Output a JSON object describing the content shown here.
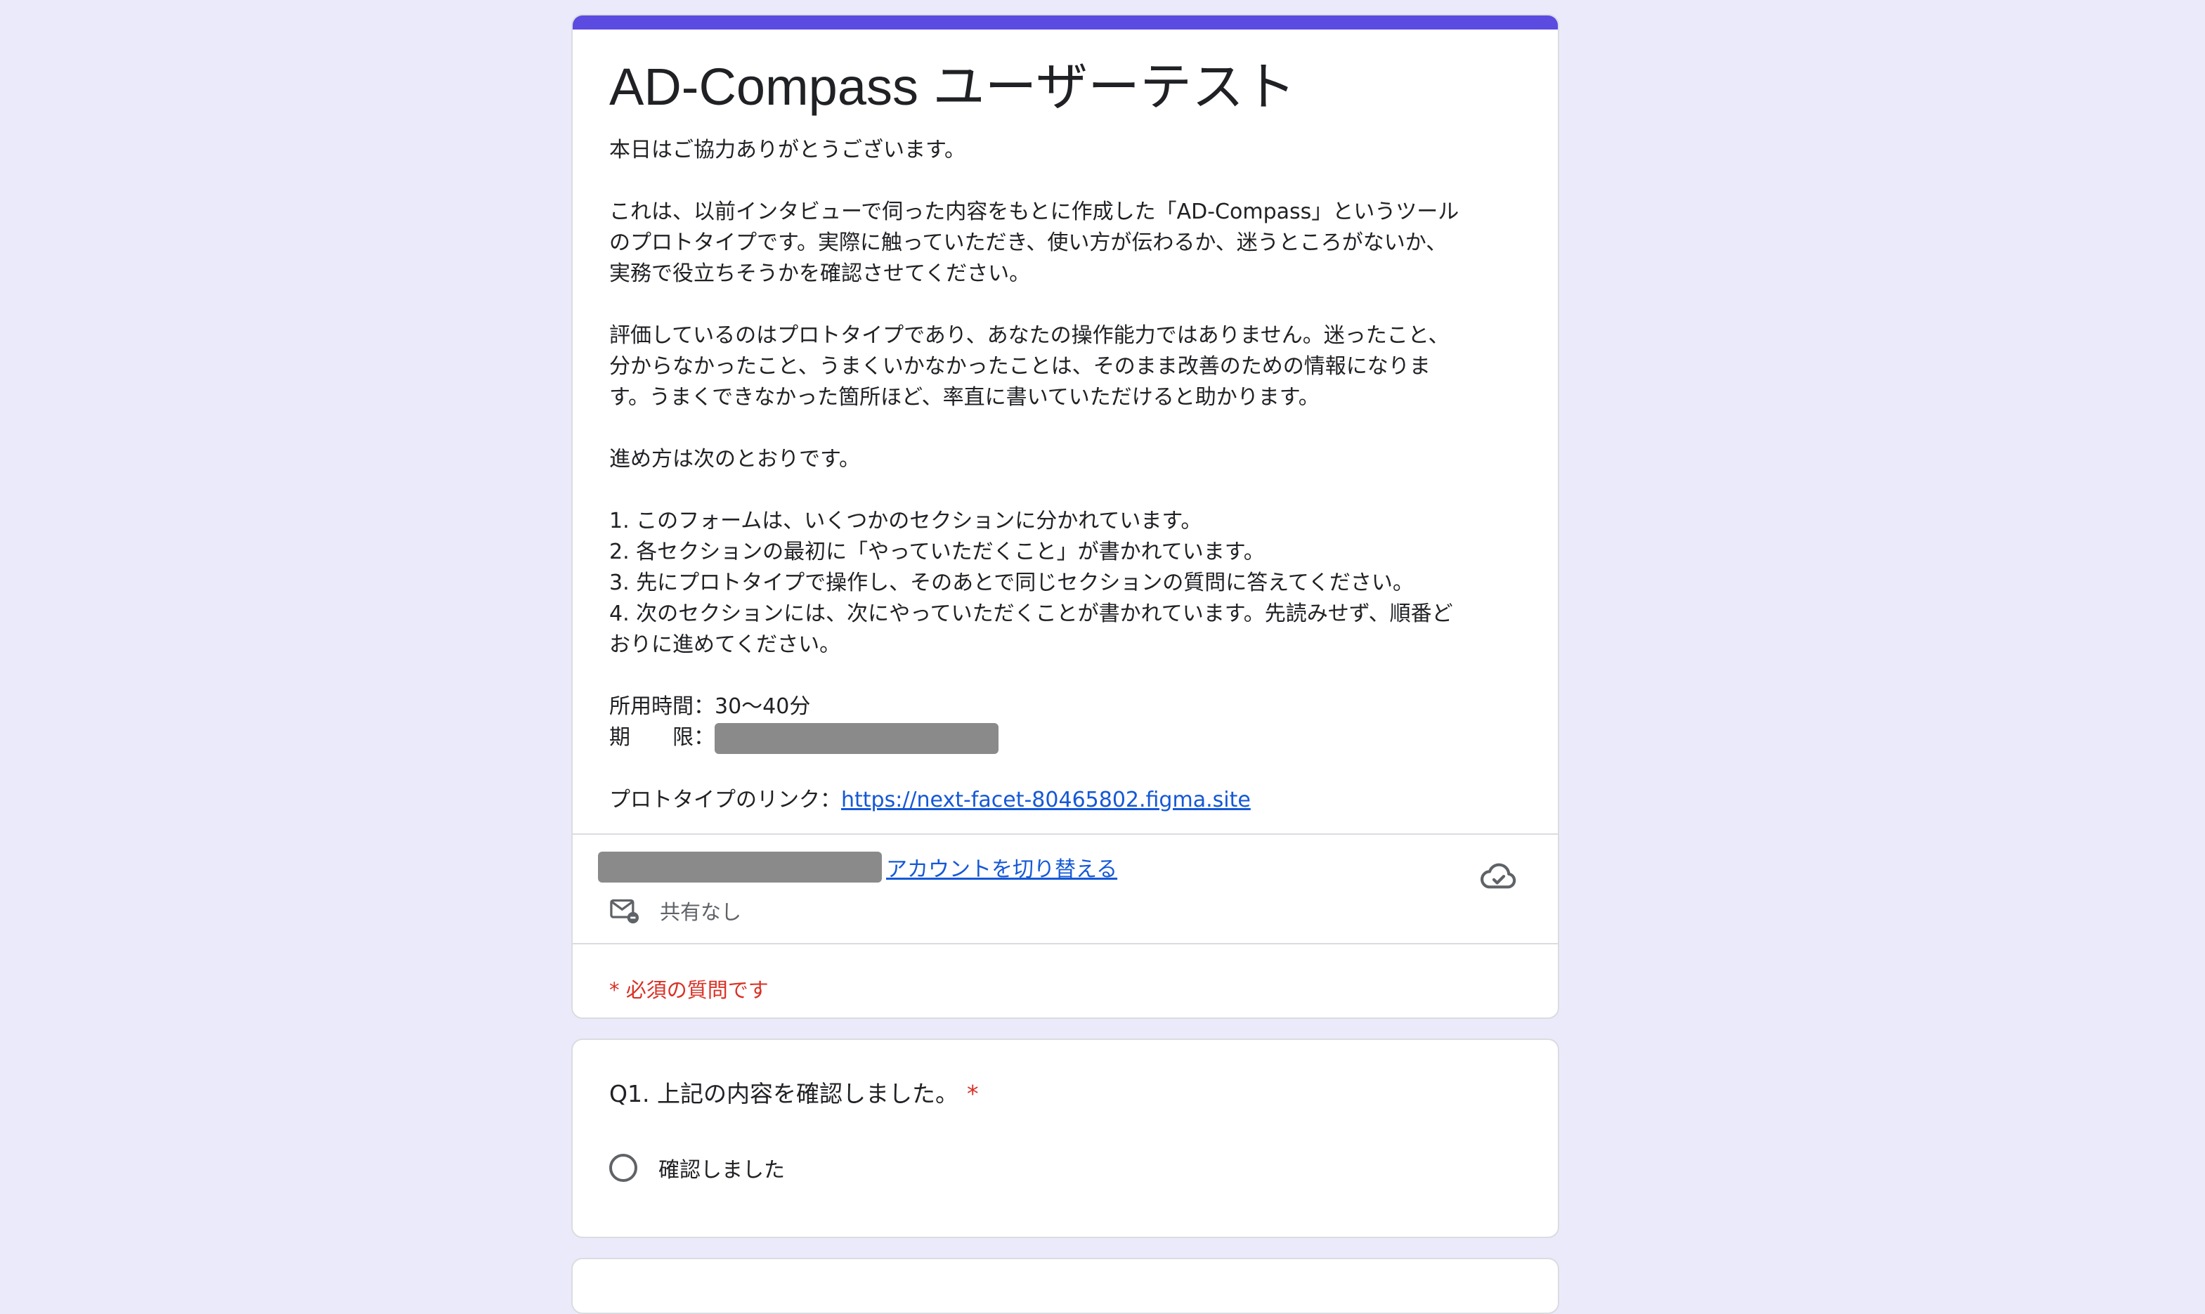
{
  "form": {
    "title": "AD-Compass ユーザーテスト",
    "description": {
      "greeting": "本日はご協力ありがとうございます。",
      "para1": [
        "これは、以前インタビューで伺った内容をもとに作成した「AD-Compass」というツール",
        "のプロトタイプです。実際に触っていただき、使い方が伝わるか、迷うところがないか、",
        "実務で役立ちそうかを確認させてください。"
      ],
      "para2": [
        "評価しているのはプロトタイプであり、あなたの操作能力ではありません。迷ったこと、",
        "分からなかったこと、うまくいかなかったことは、そのまま改善のための情報になりま",
        "す。うまくできなかった箇所ほど、率直に書いていただけると助かります。"
      ],
      "steps_intro": "進め方は次のとおりです。",
      "steps": [
        "1. このフォームは、いくつかのセクションに分かれています。",
        "2. 各セクションの最初に「やっていただくこと」が書かれています。",
        "3. 先にプロトタイプで操作し、そのあとで同じセクションの質問に答えてください。",
        "4. 次のセクションには、次にやっていただくことが書かれています。先読みせず、順番ど",
        "おりに進めてください。"
      ],
      "time_label": "所用時間：30〜40分",
      "deadline_label": "期　　限：",
      "link_label": "プロトタイプのリンク：",
      "link_url": "https://next-facet-80465802.figma.site"
    },
    "account": {
      "switch_label": "アカウントを切り替える",
      "share_status": "共有なし"
    },
    "required_note": "* 必須の質問です"
  },
  "q1": {
    "title": "Q1. 上記の内容を確認しました。",
    "required_mark": "*",
    "option": "確認しました"
  },
  "colors": {
    "accent": "#5b4be0",
    "background": "#ebeafb",
    "required": "#d93025",
    "link": "#1558d6"
  }
}
